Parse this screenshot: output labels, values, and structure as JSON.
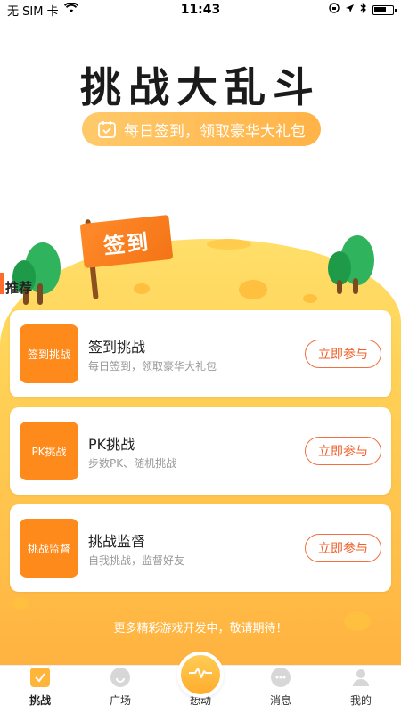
{
  "status_bar": {
    "carrier": "无 SIM 卡",
    "time": "11:43",
    "battery_fraction": 0.7
  },
  "header": {
    "title": "挑战大乱斗",
    "subtitle": "每日签到，领取豪华大礼包"
  },
  "scene": {
    "flag_text": "签到"
  },
  "section": {
    "label": "推荐"
  },
  "cards": [
    {
      "thumb": "签到挑战",
      "title": "签到挑战",
      "desc": "每日签到，领取豪华大礼包",
      "button": "立即参与"
    },
    {
      "thumb": "PK挑战",
      "title": "PK挑战",
      "desc": "步数PK、随机挑战",
      "button": "立即参与"
    },
    {
      "thumb": "挑战监督",
      "title": "挑战监督",
      "desc": "自我挑战，监督好友",
      "button": "立即参与"
    }
  ],
  "footer_note": "更多精彩游戏开发中，敬请期待！",
  "tabbar": {
    "items": [
      {
        "label": "挑战",
        "icon": "challenge-icon"
      },
      {
        "label": "广场",
        "icon": "square-icon"
      },
      {
        "label": "想动",
        "icon": "pulse-icon"
      },
      {
        "label": "消息",
        "icon": "message-icon"
      },
      {
        "label": "我的",
        "icon": "profile-icon"
      }
    ]
  },
  "colors": {
    "accent": "#ff8a1c",
    "hill": "#ffd257",
    "button_text": "#f0602a"
  }
}
